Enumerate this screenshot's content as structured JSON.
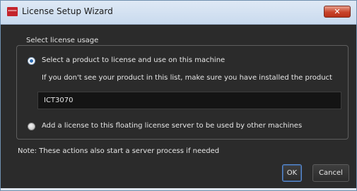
{
  "window": {
    "title": "License Setup Wizard",
    "close_icon": "close-icon",
    "app_icon": "license-app-icon"
  },
  "group": {
    "legend": "Select license usage"
  },
  "options": {
    "product": {
      "label": "Select a product to license and use on this machine",
      "hint": "If you don't see your product in this list, make sure you have installed the product",
      "selected": true,
      "product_value": "ICT3070"
    },
    "floating": {
      "label": "Add a license to this floating license server to be used by other machines",
      "selected": false
    }
  },
  "note": "Note: These actions also start a server process if needed",
  "buttons": {
    "ok": "OK",
    "cancel": "Cancel"
  },
  "colors": {
    "background": "#2b2b2b",
    "titlebar": "#c9daee",
    "close_button": "#c8432a",
    "radio_selected": "#2f6fb6"
  }
}
